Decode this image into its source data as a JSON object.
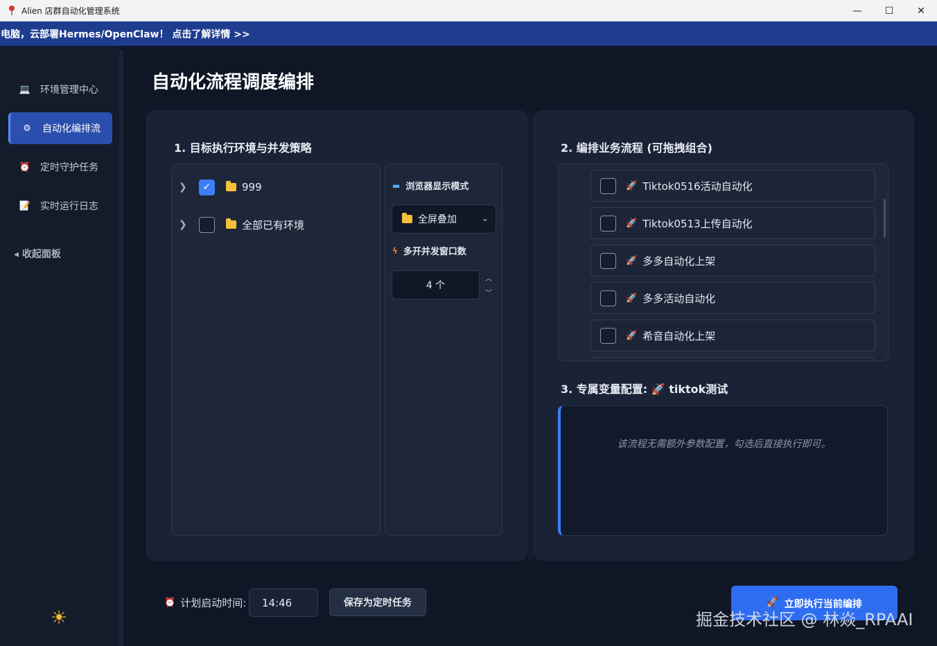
{
  "window": {
    "title": "Alien 店群自动化管理系统",
    "controls": {
      "minimize": "—",
      "maximize": "☐",
      "close": "✕"
    }
  },
  "banner": {
    "text": "电脑，云部署Hermes/OpenClaw！ 点击了解详情 >>"
  },
  "sidebar": {
    "items": [
      {
        "label": "环境管理中心",
        "icon": "laptop-icon",
        "glyph": "💻",
        "active": false
      },
      {
        "label": "自动化编排流",
        "icon": "gear-icon",
        "glyph": "⚙",
        "active": true
      },
      {
        "label": "定时守护任务",
        "icon": "alarm-clock-icon",
        "glyph": "⏰",
        "active": false
      },
      {
        "label": "实时运行日志",
        "icon": "log-file-icon",
        "glyph": "📝",
        "active": false
      }
    ],
    "collapse_label": "◂ 收起面板",
    "theme_icon": "☀"
  },
  "main": {
    "title": "自动化流程调度编排",
    "left_card": {
      "section_title": "1. 目标执行环境与并发策略",
      "tree": [
        {
          "label": "999",
          "checked": true
        },
        {
          "label": "全部已有环境",
          "checked": false
        }
      ],
      "options": {
        "display_mode_label": "浏览器显示模式",
        "display_mode_value": "全屏叠加",
        "concurrency_label": "多开并发窗口数",
        "concurrency_value": "4 个"
      }
    },
    "right_card": {
      "flow_section_title": "2. 编排业务流程 (可拖拽组合)",
      "flows": [
        {
          "label": "Tiktok0516活动自动化",
          "checked": false
        },
        {
          "label": "Tiktok0513上传自动化",
          "checked": false
        },
        {
          "label": "多多自动化上架",
          "checked": false
        },
        {
          "label": "多多活动自动化",
          "checked": false
        },
        {
          "label": "希音自动化上架",
          "checked": false
        }
      ],
      "var_section_title": "3. 专属变量配置: 🚀 tiktok测试",
      "var_hint": "该流程无需额外参数配置，勾选后直接执行即可。"
    }
  },
  "footer": {
    "schedule_label": "计划启动时间:",
    "schedule_time": "14:46",
    "save_button": "保存为定时任务",
    "run_button": "立即执行当前编排"
  },
  "watermark": "掘金技术社区 @ 林焱_RPAAI",
  "colors": {
    "accent": "#3c7ef6",
    "banner": "#1f3d8f",
    "background": "#0f1626",
    "card": "#1a2336"
  }
}
